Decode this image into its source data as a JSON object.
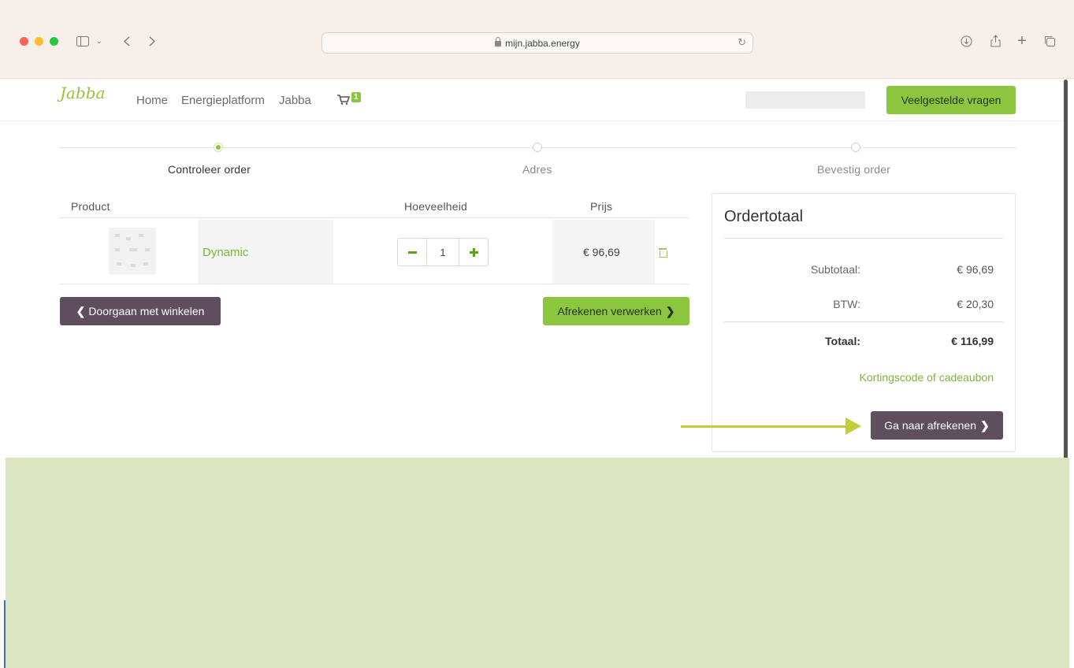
{
  "browser": {
    "url": "mijn.jabba.energy",
    "icons": [
      "sidebar-icon",
      "chevron-down-icon",
      "back-icon",
      "forward-icon",
      "reload-icon",
      "download-icon",
      "share-icon",
      "new-tab-icon",
      "tabs-overview-icon"
    ]
  },
  "nav": {
    "logo": "Jabba",
    "links": [
      "Home",
      "Energieplatform",
      "Jabba"
    ],
    "cart_count": "1",
    "faq_label": "Veelgestelde vragen"
  },
  "steps": [
    {
      "label": "Controleer order",
      "active": true
    },
    {
      "label": "Adres",
      "active": false
    },
    {
      "label": "Bevestig order",
      "active": false
    }
  ],
  "table": {
    "headers": {
      "product": "Product",
      "quantity": "Hoeveelheid",
      "price": "Prijs"
    },
    "rows": [
      {
        "name": "Dynamic",
        "quantity": "1",
        "price": "€ 96,69"
      }
    ]
  },
  "actions": {
    "continue_label": "Doorgaan met winkelen",
    "process_label": "Afrekenen verwerken"
  },
  "summary": {
    "title": "Ordertotaal",
    "subtotal_label": "Subtotaal:",
    "subtotal_value": "€ 96,69",
    "vat_label": "BTW:",
    "vat_value": "€ 20,30",
    "total_label": "Totaal:",
    "total_value": "€ 116,99",
    "discount_link": "Kortingscode of cadeaubon",
    "checkout_label": "Ga naar afrekenen"
  },
  "colors": {
    "brand_green": "#8cc63f",
    "button_dark": "#5f4e5d",
    "annotation_arrow": "#c5cd3a",
    "bottom_band": "#d9e5c1"
  }
}
